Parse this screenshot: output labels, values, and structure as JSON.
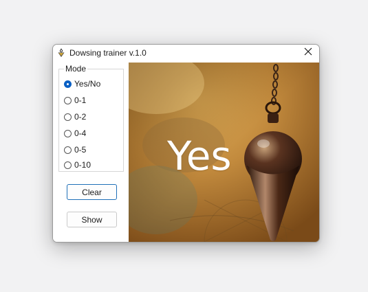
{
  "window": {
    "title": "Dowsing trainer v.1.0",
    "app_icon": "pendulum-icon",
    "close_icon": "close-icon"
  },
  "mode": {
    "legend": "Mode",
    "options": [
      {
        "label": "Yes/No",
        "checked": true
      },
      {
        "label": "0-1",
        "checked": false
      },
      {
        "label": "0-2",
        "checked": false
      },
      {
        "label": "0-4",
        "checked": false
      },
      {
        "label": "0-5",
        "checked": false
      },
      {
        "label": "0-10",
        "checked": false
      }
    ]
  },
  "buttons": {
    "clear_label": "Clear",
    "show_label": "Show"
  },
  "result": {
    "answer": "Yes"
  },
  "colors": {
    "accent": "#0b60c4",
    "focus_border": "#1e6fb8",
    "answer_text": "#ffffff"
  }
}
